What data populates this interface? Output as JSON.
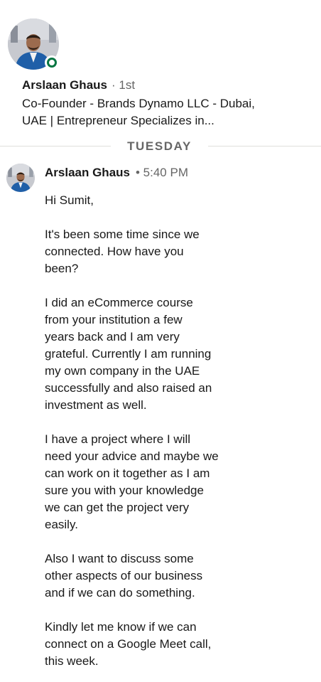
{
  "header": {
    "name": "Arslaan Ghaus",
    "degree": "· 1st",
    "headline": "Co-Founder - Brands Dynamo LLC - Dubai,\nUAE | Entrepreneur Specializes in...",
    "status": "online",
    "status_color": "#057642"
  },
  "divider": {
    "label": "TUESDAY"
  },
  "message": {
    "sender": "Arslaan Ghaus",
    "time": "• 5:40 PM",
    "paragraphs": [
      "Hi Sumit,",
      "It's been some time since we\nconnected. How have you\nbeen?",
      "I did an eCommerce course\nfrom your institution a few\nyears back and I am very\ngrateful. Currently I am running\nmy own company in the UAE\nsuccessfully and also raised an\ninvestment as well.",
      "I have a project where I will\nneed your advice and maybe we\ncan work on it together as I am\nsure you with your knowledge\nwe can get the project very\neasily.",
      "Also I want to discuss some\nother aspects of our business\nand if we can do something.",
      "Kindly let me know if we can\nconnect on a Google Meet call,\nthis week."
    ]
  },
  "colors": {
    "text": "#191919",
    "secondary": "#666666",
    "divider": "#e0dfdc",
    "jacket": "#1f5fa8"
  }
}
